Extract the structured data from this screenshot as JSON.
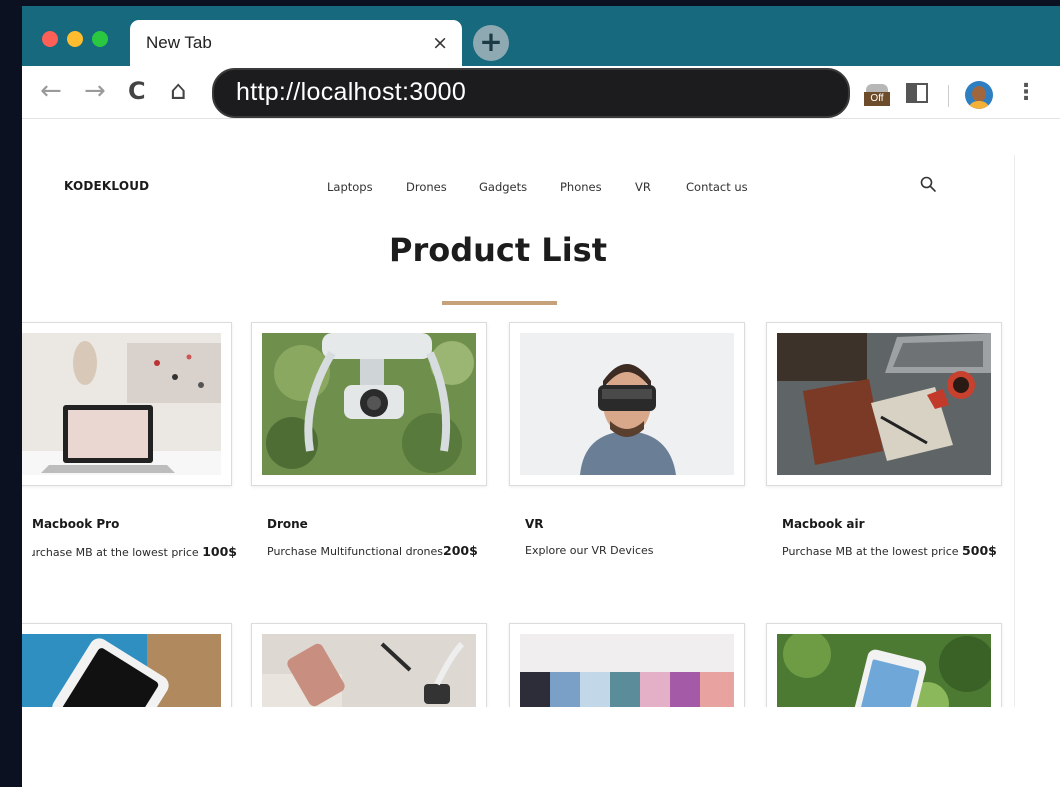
{
  "browser": {
    "tab_title": "New Tab",
    "tab_close": "×",
    "new_tab": "+",
    "url": "http://localhost:3000",
    "extension_label": "Off"
  },
  "site": {
    "brand": "KODEKLOUD",
    "menu": [
      "Laptops",
      "Drones",
      "Gadgets",
      "Phones",
      "VR",
      "Contact us"
    ],
    "page_title": "Product List"
  },
  "products": [
    {
      "name": "Macbook Pro",
      "description": "Purchase MB at the lowest price ",
      "price": "100$"
    },
    {
      "name": "Drone",
      "description": "Purchase Multifunctional drones",
      "price": "200$"
    },
    {
      "name": "VR",
      "description": "Explore our VR Devices",
      "price": ""
    },
    {
      "name": "Macbook air",
      "description": "Purchase MB at the lowest price ",
      "price": "500$"
    }
  ],
  "colors": {
    "titlebar": "#17697e",
    "accent_underline": "#c6a27a",
    "omnibox": "#1c1c1e"
  },
  "icons": [
    "back-icon",
    "forward-icon",
    "reload-icon",
    "home-icon",
    "search-icon",
    "kebab-menu-icon"
  ]
}
